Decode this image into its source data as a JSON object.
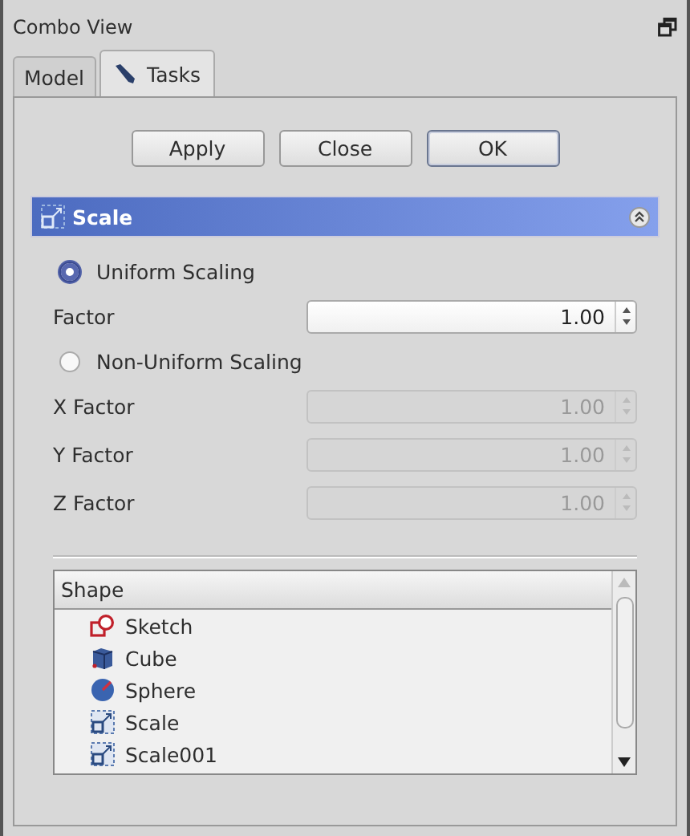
{
  "window": {
    "title": "Combo View"
  },
  "tabs": [
    {
      "label": "Model",
      "selected": false,
      "kind": "plain"
    },
    {
      "label": "Tasks",
      "selected": true,
      "kind": "pencil"
    }
  ],
  "buttons": [
    {
      "label": "Apply",
      "selected": false
    },
    {
      "label": "Close",
      "selected": false
    },
    {
      "label": "OK",
      "selected": true
    }
  ],
  "section": {
    "title": "Scale",
    "expanded": true
  },
  "options": [
    {
      "kind": "radio",
      "label": "Uniform Scaling",
      "selected": true
    },
    {
      "kind": "spin",
      "label": "Factor",
      "value": "1.00",
      "disabled": false
    },
    {
      "kind": "radio",
      "label": "Non-Uniform Scaling",
      "selected": false
    },
    {
      "kind": "spin",
      "label": "X Factor",
      "value": "1.00",
      "disabled": true
    },
    {
      "kind": "spin",
      "label": "Y Factor",
      "value": "1.00",
      "disabled": true
    },
    {
      "kind": "spin",
      "label": "Z Factor",
      "value": "1.00",
      "disabled": true
    }
  ],
  "list": {
    "column": "Shape",
    "items": [
      {
        "kind": "sketch",
        "label": "Sketch"
      },
      {
        "kind": "cube",
        "label": "Cube"
      },
      {
        "kind": "sphere",
        "label": "Sphere"
      },
      {
        "kind": "scale",
        "label": "Scale"
      },
      {
        "kind": "scale",
        "label": "Scale001"
      }
    ]
  }
}
